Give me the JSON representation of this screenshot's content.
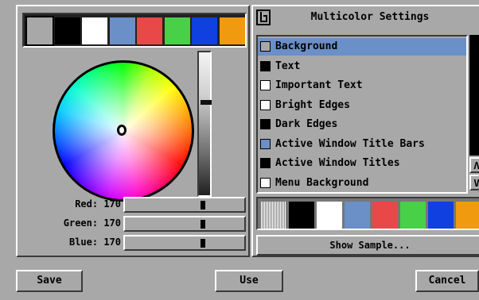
{
  "palette": {
    "colors": [
      "#a8a8a8",
      "#000000",
      "#ffffff",
      "#6b8fc7",
      "#e84848",
      "#48d048",
      "#1040e0",
      "#f09a10"
    ]
  },
  "sliders": [
    {
      "label": "Red:",
      "value": "170",
      "fraction": 0.667
    },
    {
      "label": "Green:",
      "value": "170",
      "fraction": 0.667
    },
    {
      "label": "Blue:",
      "value": "170",
      "fraction": 0.667
    }
  ],
  "brightness_fraction": 0.35,
  "settings": {
    "title": "Multicolor Settings",
    "items": [
      {
        "label": "Background",
        "color": "#a8a8a8",
        "selected": true
      },
      {
        "label": "Text",
        "color": "#000000"
      },
      {
        "label": "Important Text",
        "color": "#ffffff"
      },
      {
        "label": "Bright Edges",
        "color": "#ffffff"
      },
      {
        "label": "Dark Edges",
        "color": "#000000"
      },
      {
        "label": "Active Window Title Bars",
        "color": "#6b8fc7"
      },
      {
        "label": "Active Window Titles",
        "color": "#000000"
      },
      {
        "label": "Menu Background",
        "color": "#ffffff"
      }
    ],
    "scroll_up_label": "Λ",
    "scroll_down_label": "V",
    "show_sample_label": "Show Sample..."
  },
  "buttons": {
    "save": "Save",
    "use": "Use",
    "cancel": "Cancel"
  }
}
